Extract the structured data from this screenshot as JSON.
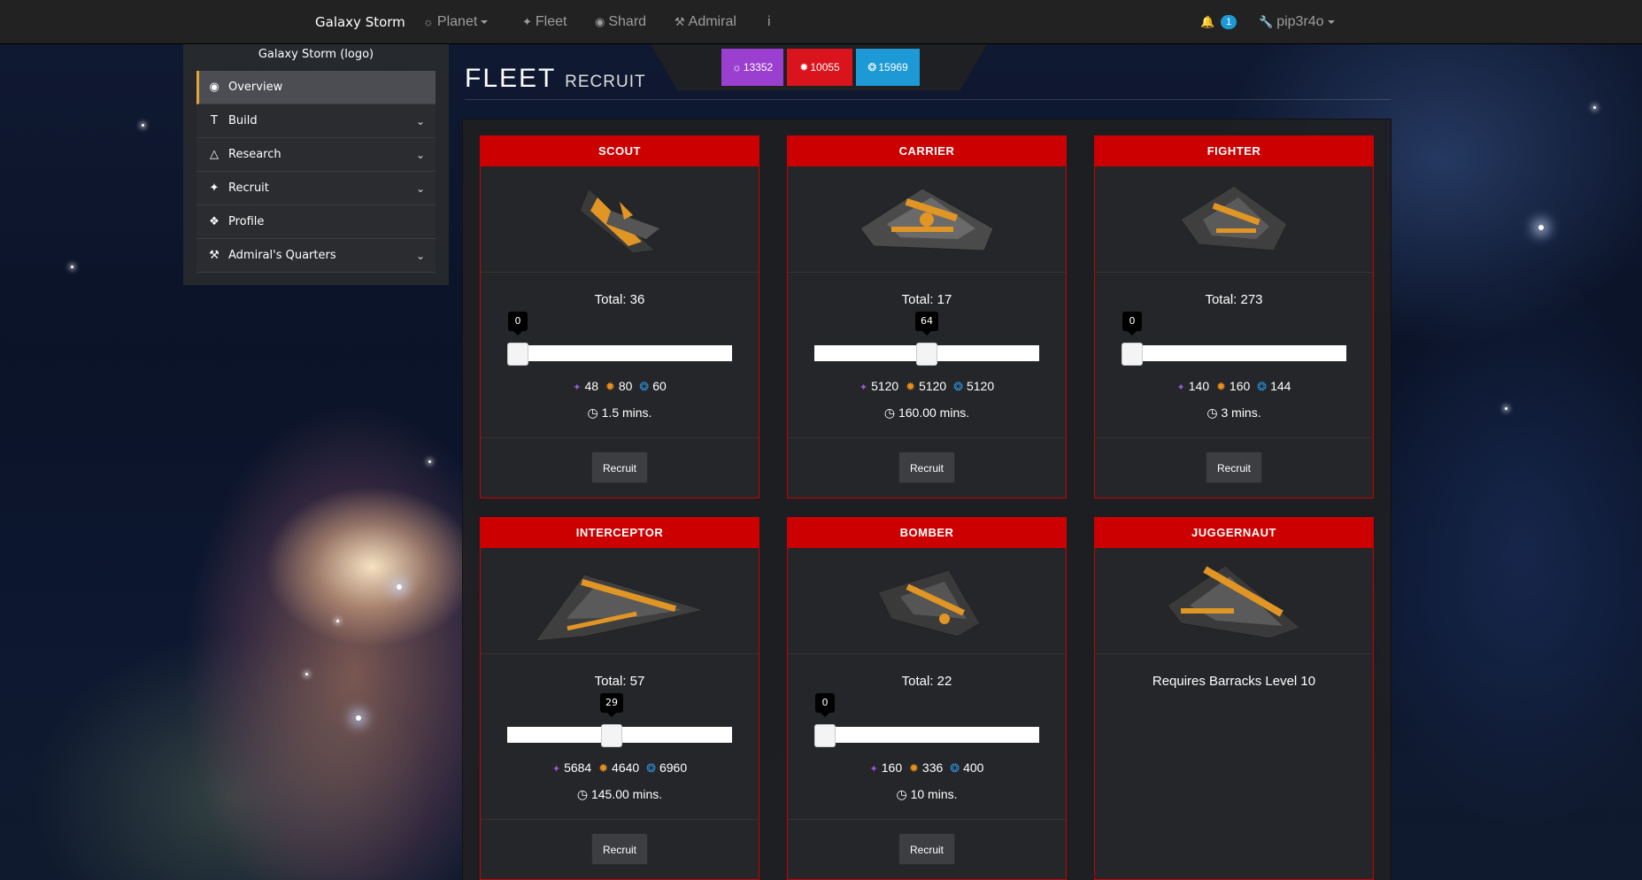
{
  "navbar": {
    "brand": "Galaxy Storm",
    "planet": "Planet",
    "fleet": "Fleet",
    "shard": "Shard",
    "admiral": "Admiral",
    "info": "i",
    "notifications_count": "1",
    "user": "pip3r4o"
  },
  "sidebar": {
    "logo_text": "Galaxy Storm (logo)",
    "items": [
      {
        "label": "Overview",
        "icon": "globe-icon"
      },
      {
        "label": "Build",
        "icon": "hammer-icon"
      },
      {
        "label": "Research",
        "icon": "flask-icon"
      },
      {
        "label": "Recruit",
        "icon": "ship-icon"
      },
      {
        "label": "Profile",
        "icon": "wrench-icon"
      },
      {
        "label": "Admiral's Quarters",
        "icon": "tools-icon"
      }
    ]
  },
  "header": {
    "title": "FLEET",
    "subtitle": "RECRUIT"
  },
  "resources": [
    {
      "value": "13352",
      "color": "#9b3fd0"
    },
    {
      "value": "10055",
      "color": "#d9141c"
    },
    {
      "value": "15969",
      "color": "#1d9ad6"
    }
  ],
  "ships": [
    {
      "name": "SCOUT",
      "total": "Total: 36",
      "slider": "0",
      "slider_fraction": 0,
      "cost_a": "48",
      "cost_b": "80",
      "cost_c": "60",
      "time": "1.5 mins.",
      "button": "Recruit"
    },
    {
      "name": "CARRIER",
      "total": "Total: 17",
      "slider": "64",
      "slider_fraction": 0.5,
      "cost_a": "5120",
      "cost_b": "5120",
      "cost_c": "5120",
      "time": "160.00 mins.",
      "button": "Recruit"
    },
    {
      "name": "FIGHTER",
      "total": "Total: 273",
      "slider": "0",
      "slider_fraction": 0,
      "cost_a": "140",
      "cost_b": "160",
      "cost_c": "144",
      "time": "3 mins.",
      "button": "Recruit"
    },
    {
      "name": "INTERCEPTOR",
      "total": "Total: 57",
      "slider": "29",
      "slider_fraction": 0.46,
      "cost_a": "5684",
      "cost_b": "4640",
      "cost_c": "6960",
      "time": "145.00 mins.",
      "button": "Recruit"
    },
    {
      "name": "BOMBER",
      "total": "Total: 22",
      "slider": "0",
      "slider_fraction": 0,
      "cost_a": "160",
      "cost_b": "336",
      "cost_c": "400",
      "time": "10 mins.",
      "button": "Recruit"
    },
    {
      "name": "JUGGERNAUT",
      "requirement": "Requires Barracks Level 10"
    }
  ]
}
